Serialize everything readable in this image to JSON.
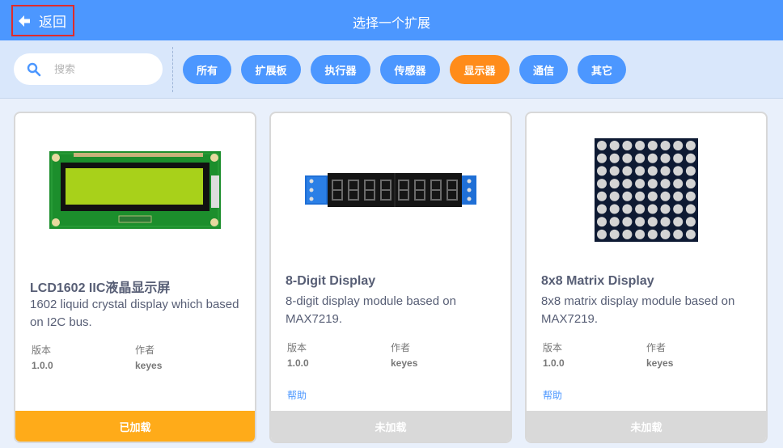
{
  "header": {
    "back_label": "返回",
    "title": "选择一个扩展"
  },
  "search": {
    "placeholder": "搜索",
    "value": ""
  },
  "tags": [
    {
      "label": "所有",
      "active": false
    },
    {
      "label": "扩展板",
      "active": false
    },
    {
      "label": "执行器",
      "active": false
    },
    {
      "label": "传感器",
      "active": false
    },
    {
      "label": "显示器",
      "active": true
    },
    {
      "label": "通信",
      "active": false
    },
    {
      "label": "其它",
      "active": false
    }
  ],
  "cards": [
    {
      "image": "lcd1602-module-image",
      "title": "LCD1602 IIC液晶显示屏",
      "description": "1602 liquid crystal display which based on I2C bus.",
      "version_label": "版本",
      "version": "1.0.0",
      "author_label": "作者",
      "author": "keyes",
      "help": "",
      "status": "已加载",
      "status_kind": "added"
    },
    {
      "image": "8-digit-display-image",
      "title": "8-Digit Display",
      "description": "8-digit display module based on MAX7219.",
      "version_label": "版本",
      "version": "1.0.0",
      "author_label": "作者",
      "author": "keyes",
      "help": "帮助",
      "status": "未加载",
      "status_kind": "not-added"
    },
    {
      "image": "8x8-matrix-display-image",
      "title": "8x8 Matrix Display",
      "description": "8x8 matrix display module based on MAX7219.",
      "version_label": "版本",
      "version": "1.0.0",
      "author_label": "作者",
      "author": "keyes",
      "help": "帮助",
      "status": "未加载",
      "status_kind": "not-added"
    }
  ],
  "colors": {
    "primary": "#4c97ff",
    "accent": "#ff8c1a",
    "added": "#ffab19",
    "not_added": "#d9d9d9"
  }
}
